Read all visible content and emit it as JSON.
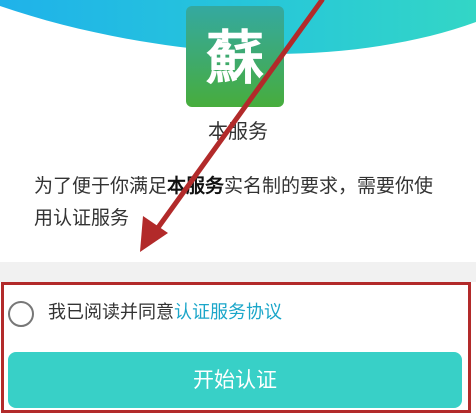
{
  "app": {
    "logo_glyph": "蘇",
    "service_name": "本服务"
  },
  "description": {
    "before": "为了便于你满足",
    "emphasis": "本服务",
    "after": "实名制的要求，需要你使用认证服务"
  },
  "agreement": {
    "prefix": "我已阅读并同意",
    "link_label": "认证服务协议",
    "checked": false
  },
  "actions": {
    "start_label": "开始认证"
  },
  "colors": {
    "brand_teal": "#38d0c7",
    "link": "#1ba6c9",
    "annotation_red": "#b22a2a"
  }
}
